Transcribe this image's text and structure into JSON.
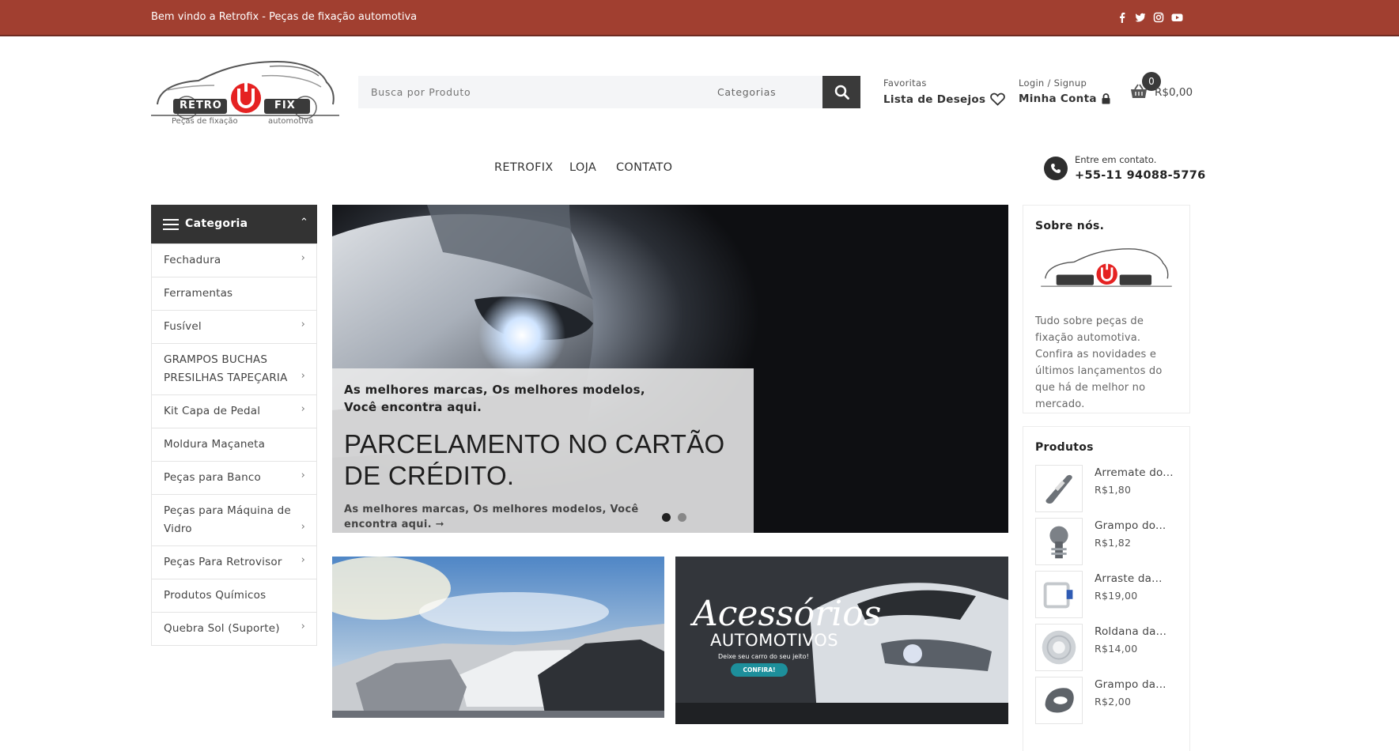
{
  "topbar": {
    "welcome": "Bem vindo a Retrofix - Peças de fixação automotiva",
    "social": [
      "facebook-icon",
      "twitter-icon",
      "instagram-icon",
      "youtube-icon"
    ]
  },
  "brand": {
    "logo_left": "RETRO",
    "logo_right": "FIX",
    "tagline_left": "Peças de fixação",
    "tagline_right": "automotiva",
    "accent": "#e52222",
    "topbar_color": "#a13f30"
  },
  "search": {
    "placeholder": "Busca por Produto",
    "category_label": "Categorias"
  },
  "header": {
    "wishlist_small": "Favoritas",
    "wishlist_big": "Lista de Desejos",
    "account_small": "Login / Signup",
    "account_big": "Minha Conta",
    "cart_count": "0",
    "cart_total": "R$0,00"
  },
  "nav": {
    "items": [
      "RETROFIX",
      "LOJA",
      "CONTATO"
    ],
    "contact_small": "Entre em contato.",
    "phone": "+55-11 94088-5776"
  },
  "sidebar": {
    "title": "Categoria",
    "items": [
      {
        "label": "Fechadura",
        "has_sub": true
      },
      {
        "label": "Ferramentas",
        "has_sub": false
      },
      {
        "label": "Fusível",
        "has_sub": true
      },
      {
        "label": "GRAMPOS BUCHAS PRESILHAS TAPEÇARIA",
        "has_sub": true
      },
      {
        "label": "Kit Capa de Pedal",
        "has_sub": true
      },
      {
        "label": "Moldura Maçaneta",
        "has_sub": false
      },
      {
        "label": "Peças para Banco",
        "has_sub": true
      },
      {
        "label": "Peças para Máquina de Vidro",
        "has_sub": true
      },
      {
        "label": "Peças Para Retrovisor",
        "has_sub": true
      },
      {
        "label": "Produtos Químicos",
        "has_sub": false
      },
      {
        "label": "Quebra Sol (Suporte)",
        "has_sub": true
      }
    ]
  },
  "hero": {
    "subtitle": "As melhores marcas, Os melhores modelos, Você encontra aqui.",
    "title": "PARCELAMENTO NO CARTÃO DE CRÉDITO.",
    "link": "As melhores marcas, Os melhores modelos, Você encontra aqui. ➞"
  },
  "banner2": {
    "script": "Acessórios",
    "title": "AUTOMOTIVOS",
    "sub": "Deixe seu carro do seu jeito!",
    "button": "CONFIRA!"
  },
  "about": {
    "title": "Sobre nós.",
    "text": "Tudo sobre peças de fixação automotiva. Confira as novidades e últimos lançamentos do que há de melhor no mercado."
  },
  "products": {
    "title": "Produtos",
    "items": [
      {
        "name": "Arremate do...",
        "price": "R$1,80"
      },
      {
        "name": "Grampo do...",
        "price": "R$1,82"
      },
      {
        "name": "Arraste da...",
        "price": "R$19,00"
      },
      {
        "name": "Roldana da...",
        "price": "R$14,00"
      },
      {
        "name": "Grampo da...",
        "price": "R$2,00"
      }
    ]
  }
}
